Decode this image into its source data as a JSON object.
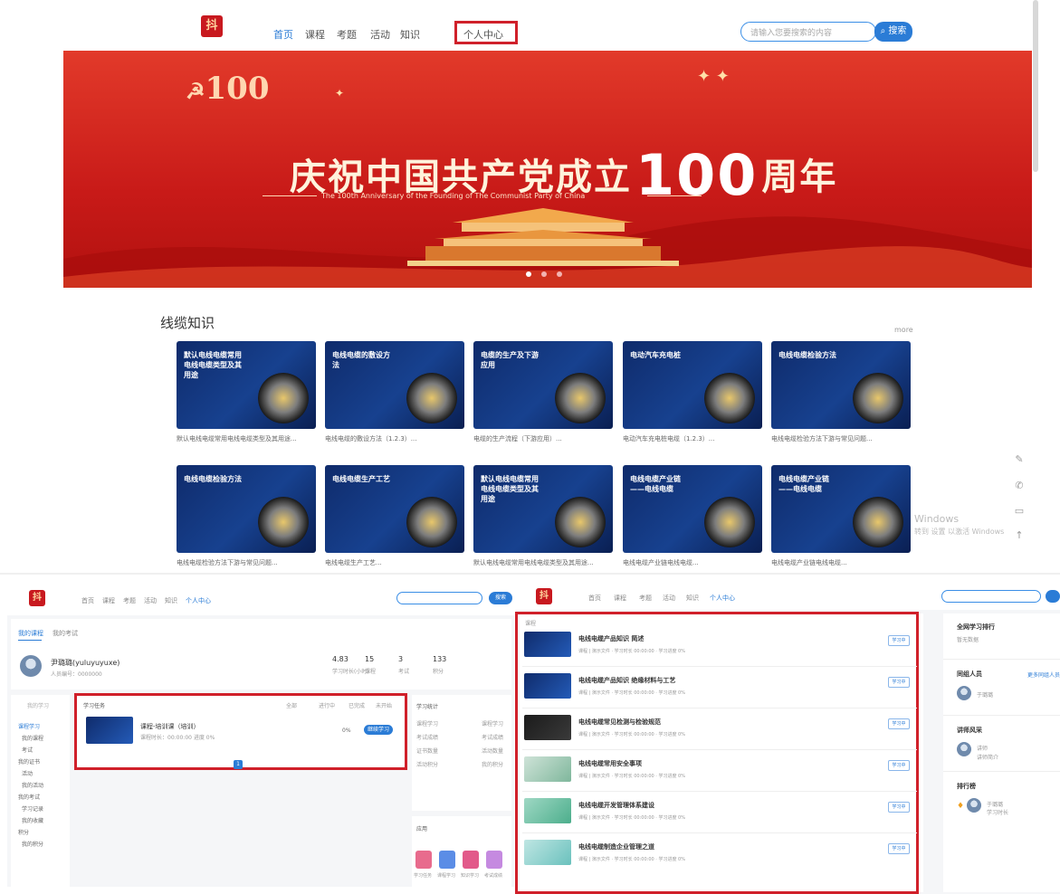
{
  "top": {
    "logo": "抖",
    "nav": [
      "首页",
      "课程",
      "考题",
      "活动",
      "知识",
      "个人中心"
    ],
    "active_index": 0,
    "highlighted": "个人中心",
    "search_placeholder": "请输入您要搜索的内容",
    "search_button": "搜索"
  },
  "banner": {
    "title_pre": "庆祝中国共产党成立",
    "title_num": "100",
    "title_post": "周年",
    "subtitle": "The 100th Anniversary of the Founding of The Communist Party of China",
    "badge": "100"
  },
  "section": {
    "title": "线缆知识",
    "more": "more"
  },
  "cards": [
    {
      "caption": "默认电线电缆常用电线电缆类型及其用途",
      "title": "默认电线电缆常用电线电缆类型及其用途..."
    },
    {
      "caption": "电线电缆的敷设方法",
      "title": "电线电缆的敷设方法（1.2.3）..."
    },
    {
      "caption": "电缆的生产及下游应用",
      "title": "电缆的生产流程（下游应用）..."
    },
    {
      "caption": "电动汽车充电桩",
      "title": "电动汽车充电桩电缆（1.2.3）..."
    },
    {
      "caption": "电线电缆检验方法",
      "title": "电线电缆检验方法下游与常见问题..."
    },
    {
      "caption": "电线电缆检验方法",
      "title": "电线电缆检验方法下游与常见问题..."
    },
    {
      "caption": "电线电缆生产工艺",
      "title": "电线电缆生产工艺..."
    },
    {
      "caption": "默认电线电缆常用电线电缆类型及其用途",
      "title": "默认电线电缆常用电线电缆类型及其用途..."
    },
    {
      "caption": "电线电缆产业链——电线电缆",
      "title": "电线电缆产业链电线电缆..."
    },
    {
      "caption": "电线电缆产业链——电线电缆",
      "title": "电线电缆产业链电线电缆..."
    }
  ],
  "side_tools": [
    "✎",
    "✆",
    "▭",
    "↑"
  ],
  "watermark": [
    "Windows",
    "转到 设置 以激活 Windows"
  ],
  "left_panel": {
    "tabs": [
      "我的课程",
      "我的考试"
    ],
    "user_name": "尹璐璐(yuluyuyuxe)",
    "user_sub": "人员编号：0000000",
    "stats": [
      {
        "value": "4.83",
        "label": "学习时长(小时)"
      },
      {
        "value": "15",
        "label": "课程"
      },
      {
        "value": "3",
        "label": "考试"
      },
      {
        "value": "133",
        "label": "积分"
      }
    ],
    "menu": [
      "我的学习",
      "课程学习",
      "我的课程",
      "考试",
      "我的证书",
      "活动",
      "我的活动",
      "我的考试",
      "学习记录",
      "我的收藏",
      "积分",
      "我的积分"
    ],
    "list_header": "学习任务",
    "filters": [
      "全部",
      "进行中",
      "已完成",
      "未开始"
    ],
    "course_name": "课程-培训课（培训）",
    "course_meta": "课程时长：00:00:00 进度 0%",
    "start_label": "继续学习",
    "page": "1",
    "right_title": "学习统计",
    "right_items": [
      "课程学习",
      "课程学习",
      "考试成绩",
      "考试成绩",
      "证书数量",
      "活动数量",
      "活动积分",
      "我的积分"
    ],
    "apps_title": "应用",
    "apps": [
      "学习任务",
      "课程学习",
      "知识学习",
      "考试成绩"
    ]
  },
  "right_panel": {
    "top_label": "课程",
    "items": [
      {
        "name": "电线电缆产品知识 简述",
        "meta": "课程 | 演示文件 · 学习时长 00:00:00 · 学习进度 0%",
        "tag": "学习中"
      },
      {
        "name": "电线电缆产品知识 绝缘材料与工艺",
        "meta": "课程 | 演示文件 · 学习时长 00:00:00 · 学习进度 0%",
        "tag": "学习中"
      },
      {
        "name": "电线电缆常见检测与检验规范",
        "meta": "课程 | 演示文件 · 学习时长 00:00:00 · 学习进度 0%",
        "tag": "学习中"
      },
      {
        "name": "电线电缆常用安全事项",
        "meta": "课程 | 演示文件 · 学习时长 00:00:00 · 学习进度 0%",
        "tag": "学习中"
      },
      {
        "name": "电线电缆开发管理体系建设",
        "meta": "课程 | 演示文件 · 学习时长 00:00:00 · 学习进度 0%",
        "tag": "学习中"
      },
      {
        "name": "电线电缆制造企业管理之道",
        "meta": "课程 | 演示文件 · 学习时长 00:00:00 · 学习进度 0%",
        "tag": "学习中"
      }
    ],
    "side": [
      {
        "title": "全网学习排行",
        "sub": "暂无数据"
      },
      {
        "title": "同组人员",
        "link": "更多同组人员",
        "name": "于璐璐"
      },
      {
        "title": "讲师风采",
        "name": "讲师",
        "sub": "讲师简介"
      },
      {
        "title": "排行榜",
        "name": "于璐璐",
        "sub": "学习时长"
      }
    ]
  },
  "colors": {
    "brand_red": "#c8191f",
    "accent_blue": "#2b7cd6",
    "highlight": "#d0202a"
  }
}
